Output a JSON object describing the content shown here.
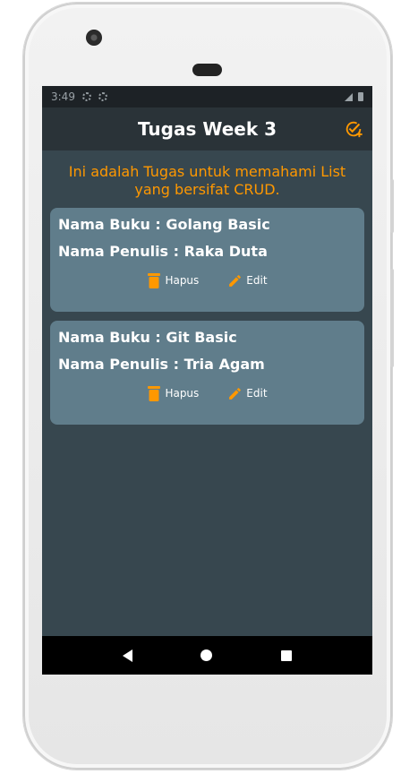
{
  "statusbar": {
    "time": "3:49"
  },
  "appbar": {
    "title": "Tugas Week 3",
    "action_icon": "add-task-icon"
  },
  "intro": {
    "text": "Ini adalah Tugas untuk memahami List yang bersifat CRUD."
  },
  "cards": [
    {
      "title": "Nama Buku : Golang Basic",
      "author": "Nama Penulis : Raka Duta",
      "delete_label": "Hapus",
      "edit_label": "Edit"
    },
    {
      "title": "Nama Buku : Git Basic",
      "author": "Nama Penulis : Tria Agam",
      "delete_label": "Hapus",
      "edit_label": "Edit"
    }
  ],
  "colors": {
    "accent": "#ff9800",
    "card": "#607d8b",
    "screen_bg": "#37474f",
    "appbar_bg": "#2a3338"
  }
}
